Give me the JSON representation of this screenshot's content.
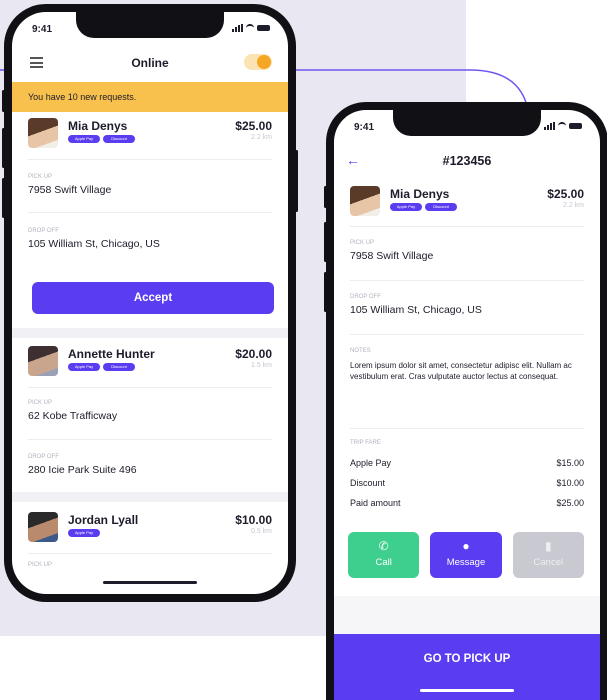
{
  "colors": {
    "accent": "#5a3df0",
    "banner": "#f8c04d",
    "toggle": "#f5a623",
    "call": "#3ecf8e",
    "cancel": "#c9c9d2",
    "background_panel": "#e9e8f2"
  },
  "phone_left": {
    "status": {
      "time": "9:41"
    },
    "header": {
      "title": "Online",
      "menu_icon": "menu-icon",
      "toggle_state": "on"
    },
    "banner": {
      "text": "You have 10 new requests."
    },
    "requests": [
      {
        "name": "Mia Denys",
        "tags": [
          "Apple Pay",
          "Discount"
        ],
        "price": "$25.00",
        "distance": "2.2 km",
        "pickup_label": "PICK UP",
        "pickup": "7958 Swift Village",
        "dropoff_label": "DROP OFF",
        "dropoff": "105 William St, Chicago, US",
        "action": "Accept"
      },
      {
        "name": "Annette Hunter",
        "tags": [
          "Apple Pay",
          "Discount"
        ],
        "price": "$20.00",
        "distance": "1.5 km",
        "pickup_label": "PICK UP",
        "pickup": "62 Kobe Trafficway",
        "dropoff_label": "DROP OFF",
        "dropoff": "280 Icie Park Suite 496"
      },
      {
        "name": "Jordan Lyall",
        "tags": [
          "Apple Pay"
        ],
        "price": "$10.00",
        "distance": "0.5 km",
        "pickup_label": "PICK UP"
      }
    ]
  },
  "phone_right": {
    "status": {
      "time": "9:41"
    },
    "header": {
      "title": "#123456",
      "back_icon": "back-arrow-icon"
    },
    "ride": {
      "name": "Mia Denys",
      "tags": [
        "Apple Pay",
        "Discount"
      ],
      "price": "$25.00",
      "distance": "2.2 km",
      "pickup_label": "PICK UP",
      "pickup": "7958 Swift Village",
      "dropoff_label": "DROP OFF",
      "dropoff": "105 William St, Chicago, US",
      "notes_label": "NOTES",
      "notes": "Lorem ipsum dolor sit amet, consectetur adipisc elit. Nullam ac vestibulum erat. Cras vulputate auctor lectus at consequat.",
      "fare_label": "TRIP FARE",
      "fare": [
        {
          "label": "Apple Pay",
          "value": "$15.00"
        },
        {
          "label": "Discount",
          "value": "$10.00"
        },
        {
          "label": "Paid amount",
          "value": "$25.00"
        }
      ]
    },
    "actions": {
      "call": {
        "label": "Call",
        "icon": "phone-icon"
      },
      "message": {
        "label": "Message",
        "icon": "chat-icon"
      },
      "cancel": {
        "label": "Cancel",
        "icon": "trash-icon"
      }
    },
    "cta": {
      "label": "GO TO PICK UP"
    }
  }
}
